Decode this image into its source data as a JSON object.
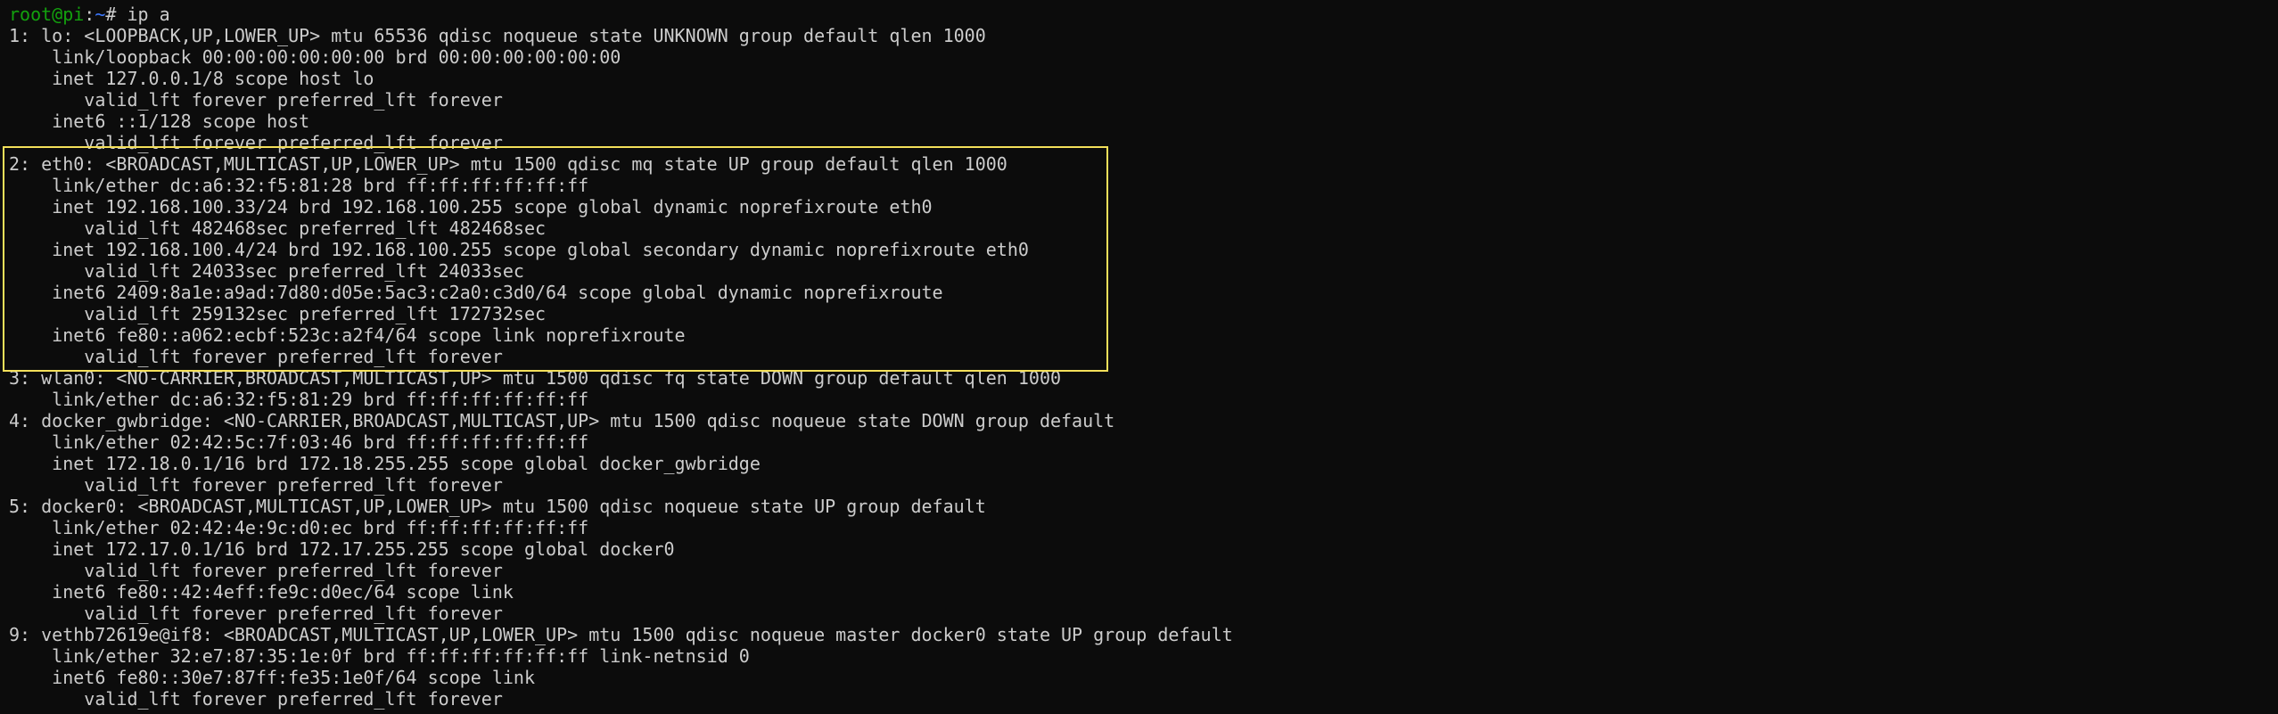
{
  "prompt": {
    "user_host": "root@pi",
    "path": "~",
    "symbol": "# ",
    "command": "ip a"
  },
  "highlight": {
    "color": "#f4e05a",
    "covers_interface": "eth0"
  },
  "colors": {
    "background": "#0c0c0c",
    "text": "#cccccc",
    "prompt_user": "#13a10e",
    "prompt_path": "#3b78ff"
  },
  "output_lines": [
    "1: lo: <LOOPBACK,UP,LOWER_UP> mtu 65536 qdisc noqueue state UNKNOWN group default qlen 1000",
    "    link/loopback 00:00:00:00:00:00 brd 00:00:00:00:00:00",
    "    inet 127.0.0.1/8 scope host lo",
    "       valid_lft forever preferred_lft forever",
    "    inet6 ::1/128 scope host",
    "       valid_lft forever preferred_lft forever",
    "2: eth0: <BROADCAST,MULTICAST,UP,LOWER_UP> mtu 1500 qdisc mq state UP group default qlen 1000",
    "    link/ether dc:a6:32:f5:81:28 brd ff:ff:ff:ff:ff:ff",
    "    inet 192.168.100.33/24 brd 192.168.100.255 scope global dynamic noprefixroute eth0",
    "       valid_lft 482468sec preferred_lft 482468sec",
    "    inet 192.168.100.4/24 brd 192.168.100.255 scope global secondary dynamic noprefixroute eth0",
    "       valid_lft 24033sec preferred_lft 24033sec",
    "    inet6 2409:8a1e:a9ad:7d80:d05e:5ac3:c2a0:c3d0/64 scope global dynamic noprefixroute",
    "       valid_lft 259132sec preferred_lft 172732sec",
    "    inet6 fe80::a062:ecbf:523c:a2f4/64 scope link noprefixroute",
    "       valid_lft forever preferred_lft forever",
    "3: wlan0: <NO-CARRIER,BROADCAST,MULTICAST,UP> mtu 1500 qdisc fq state DOWN group default qlen 1000",
    "    link/ether dc:a6:32:f5:81:29 brd ff:ff:ff:ff:ff:ff",
    "4: docker_gwbridge: <NO-CARRIER,BROADCAST,MULTICAST,UP> mtu 1500 qdisc noqueue state DOWN group default",
    "    link/ether 02:42:5c:7f:03:46 brd ff:ff:ff:ff:ff:ff",
    "    inet 172.18.0.1/16 brd 172.18.255.255 scope global docker_gwbridge",
    "       valid_lft forever preferred_lft forever",
    "5: docker0: <BROADCAST,MULTICAST,UP,LOWER_UP> mtu 1500 qdisc noqueue state UP group default",
    "    link/ether 02:42:4e:9c:d0:ec brd ff:ff:ff:ff:ff:ff",
    "    inet 172.17.0.1/16 brd 172.17.255.255 scope global docker0",
    "       valid_lft forever preferred_lft forever",
    "    inet6 fe80::42:4eff:fe9c:d0ec/64 scope link",
    "       valid_lft forever preferred_lft forever",
    "9: vethb72619e@if8: <BROADCAST,MULTICAST,UP,LOWER_UP> mtu 1500 qdisc noqueue master docker0 state UP group default",
    "    link/ether 32:e7:87:35:1e:0f brd ff:ff:ff:ff:ff:ff link-netnsid 0",
    "    inet6 fe80::30e7:87ff:fe35:1e0f/64 scope link",
    "       valid_lft forever preferred_lft forever"
  ]
}
